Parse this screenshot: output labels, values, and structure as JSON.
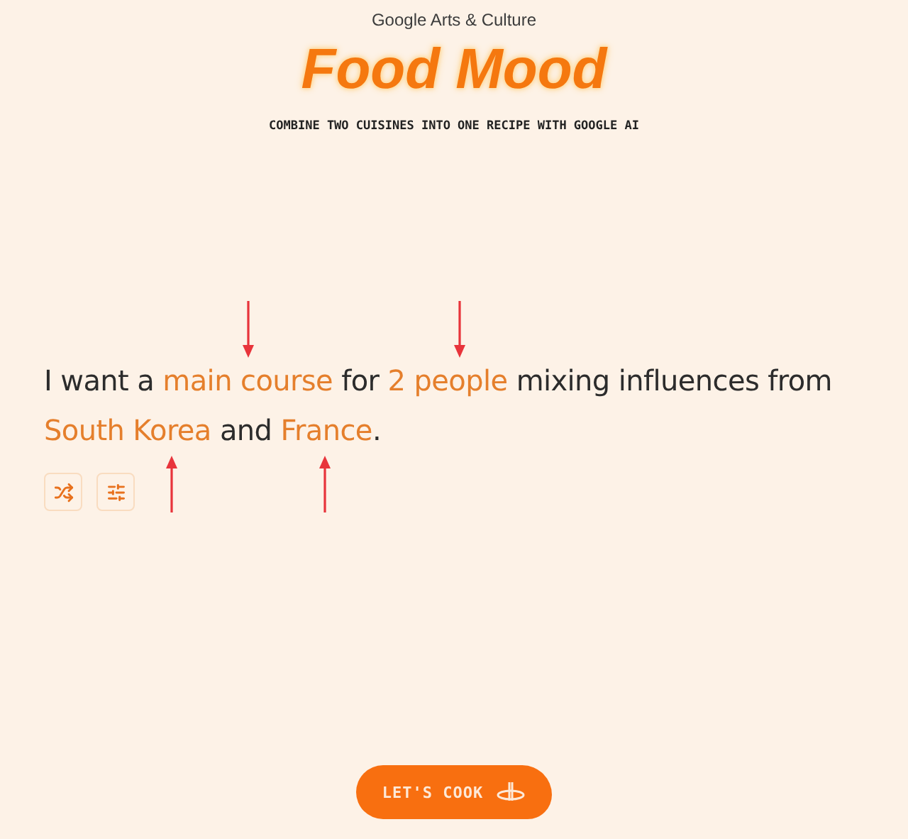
{
  "brand": "Google Arts & Culture",
  "title": "Food Mood",
  "subtitle": "COMBINE TWO CUISINES INTO ONE RECIPE WITH GOOGLE AI",
  "sentence": [
    {
      "kind": "text",
      "text": "I want a "
    },
    {
      "kind": "choice",
      "text": "main course",
      "arrow_above": true,
      "arrow_below": false
    },
    {
      "kind": "text",
      "text": " for "
    },
    {
      "kind": "choice",
      "text": "2 people",
      "arrow_above": true,
      "arrow_below": false
    },
    {
      "kind": "text",
      "text": " mixing influences from "
    },
    {
      "kind": "choice",
      "text": "South Korea",
      "arrow_above": false,
      "arrow_below": true
    },
    {
      "kind": "text",
      "text": " and "
    },
    {
      "kind": "choice",
      "text": "France",
      "arrow_above": false,
      "arrow_below": true
    },
    {
      "kind": "text",
      "text": "."
    }
  ],
  "tools": [
    {
      "kind": "shuffle"
    },
    {
      "kind": "settings"
    }
  ],
  "cook_button": {
    "label": "LET'S COOK"
  }
}
